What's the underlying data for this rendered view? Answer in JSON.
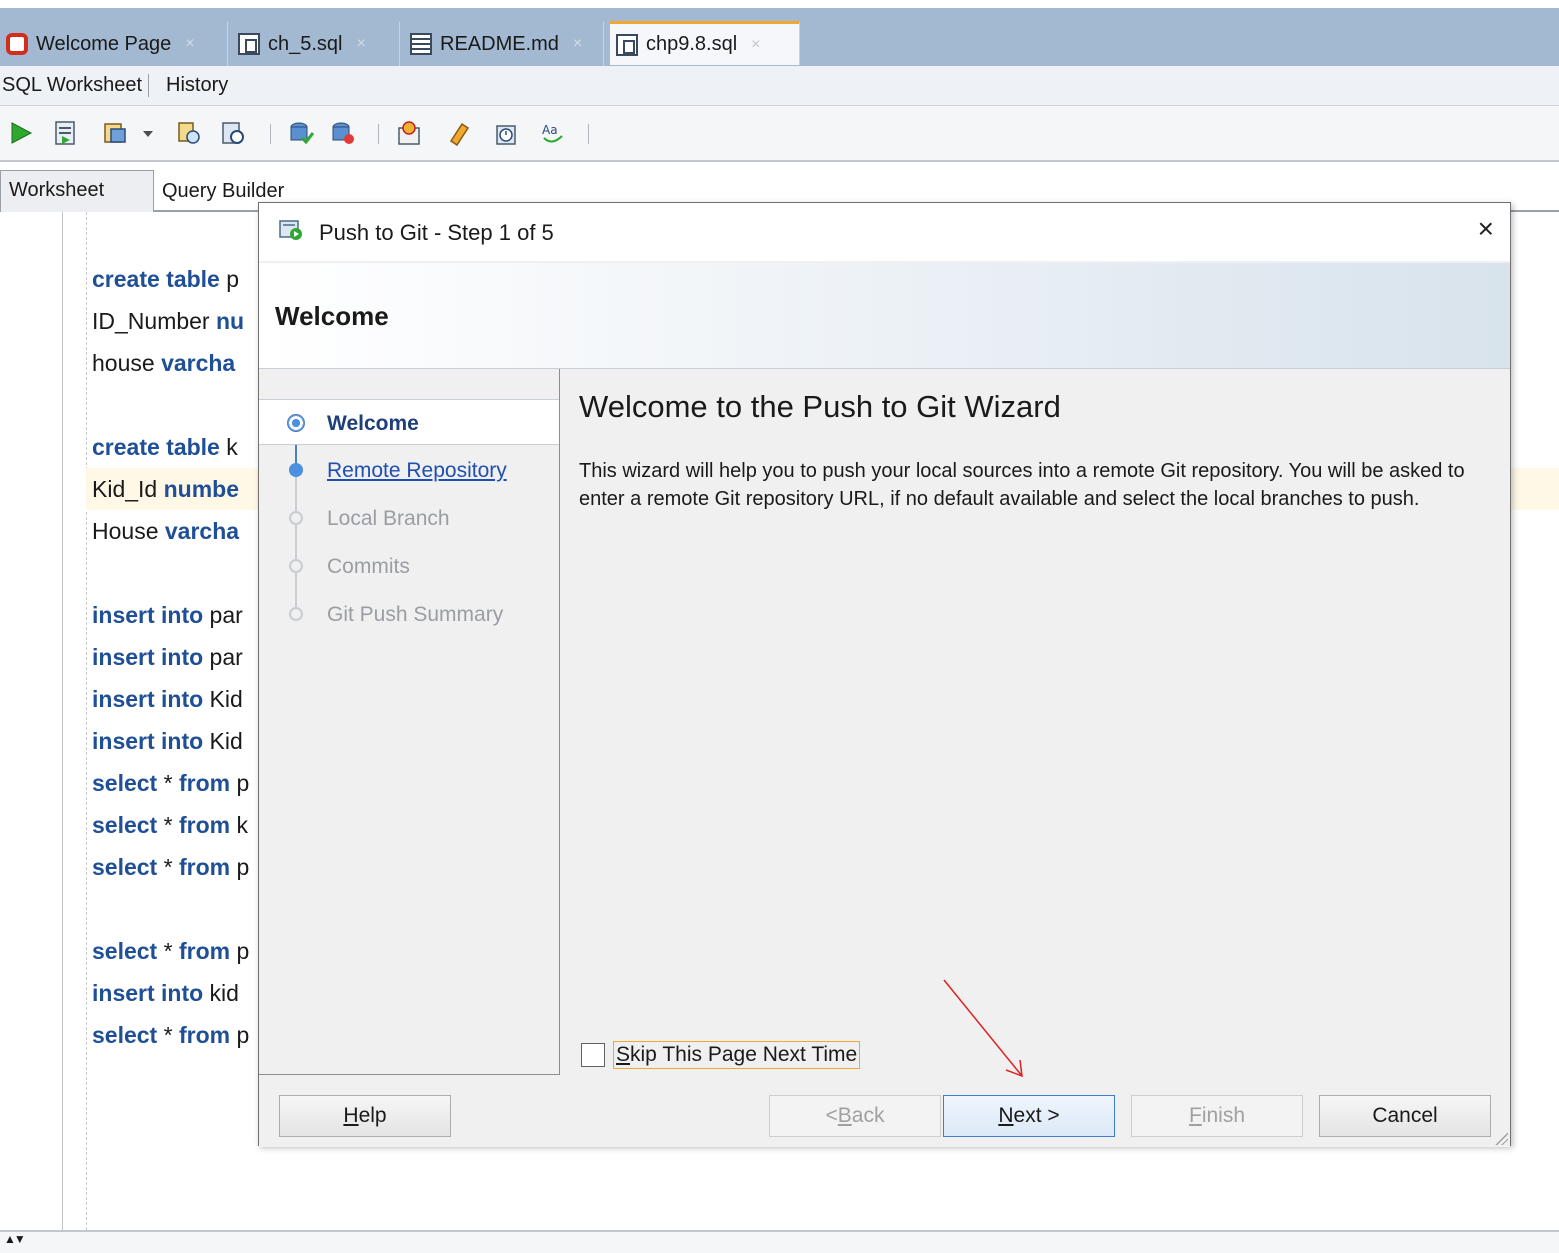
{
  "tabs": [
    {
      "label": "Welcome Page",
      "icon": "oracle-logo-icon",
      "active": false
    },
    {
      "label": "ch_5.sql",
      "icon": "sql-file-icon",
      "active": false
    },
    {
      "label": "README.md",
      "icon": "text-file-icon",
      "active": false
    },
    {
      "label": "chp9.8.sql",
      "icon": "sql-file-icon",
      "active": true
    }
  ],
  "tab_close_glyph": "×",
  "sheet_tabs": {
    "sql_worksheet": "SQL Worksheet",
    "history": "History"
  },
  "sub_tabs": {
    "worksheet": "Worksheet",
    "query_builder": "Query Builder"
  },
  "editor": {
    "lines": [
      {
        "kw": "create table",
        "rest": " p"
      },
      {
        "kw": "",
        "rest": "ID_Number ",
        "kw2": "nu"
      },
      {
        "kw": "",
        "rest": "house ",
        "kw2": "varcha"
      },
      {
        "kw": "create table",
        "rest": " k"
      },
      {
        "kw": "",
        "rest": "Kid_Id ",
        "kw2": "numbe"
      },
      {
        "kw": "",
        "rest": "House ",
        "kw2": "varcha"
      },
      {
        "kw": "insert into",
        "rest": " par"
      },
      {
        "kw": "insert into",
        "rest": " par"
      },
      {
        "kw": "insert into",
        "rest": " Kid"
      },
      {
        "kw": "insert into",
        "rest": " Kid"
      },
      {
        "kw": "select",
        "star": " * ",
        "kw2": "from",
        "rest": " p"
      },
      {
        "kw": "select",
        "star": " * ",
        "kw2": "from",
        "rest": " k"
      },
      {
        "kw": "select",
        "star": " * ",
        "kw2": "from",
        "rest": " p"
      },
      {
        "kw": "select",
        "star": " * ",
        "kw2": "from",
        "rest": " p"
      },
      {
        "kw": "insert into",
        "rest": " kid"
      },
      {
        "kw": "select",
        "star": " * ",
        "kw2": "from",
        "rest": " p"
      }
    ]
  },
  "dialog": {
    "title": "Push to Git - Step 1 of 5",
    "close_glyph": "×",
    "header_title": "Welcome",
    "steps": [
      {
        "label": "Welcome",
        "state": "current"
      },
      {
        "label": "Remote Repository",
        "state": "link"
      },
      {
        "label": "Local Branch",
        "state": "disabled"
      },
      {
        "label": "Commits",
        "state": "disabled"
      },
      {
        "label": "Git Push Summary",
        "state": "disabled"
      }
    ],
    "content_heading": "Welcome to the Push to Git Wizard",
    "content_body": "This wizard will help you to push your local sources into a remote Git repository. You will be asked to enter a remote Git repository URL, if no default available and select the local branches to push.",
    "skip_label": "Skip This Page Next Time",
    "skip_checked": false,
    "buttons": {
      "help": "Help",
      "back": "< Back",
      "next": "Next >",
      "finish": "Finish",
      "cancel": "Cancel"
    }
  },
  "colors": {
    "tabstrip": "#a3b8d1",
    "keyword": "#1f4f96",
    "annotation_arrow": "#e02020",
    "active_tab_accent": "#f0a830"
  }
}
